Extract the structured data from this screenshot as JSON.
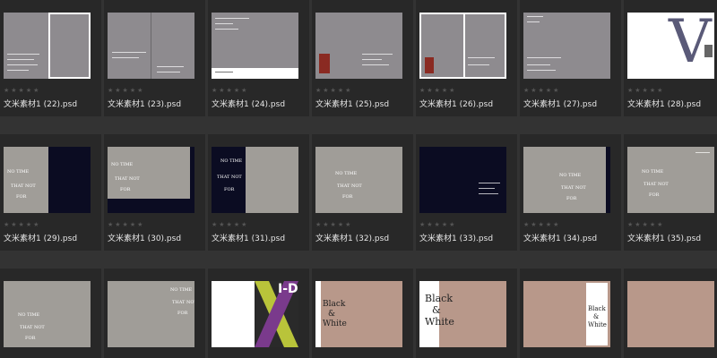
{
  "files": [
    {
      "name": "文米素材1 (22).psd",
      "stars": "★★★★★"
    },
    {
      "name": "文米素材1 (23).psd",
      "stars": "★★★★★"
    },
    {
      "name": "文米素材1 (24).psd",
      "stars": "★★★★★"
    },
    {
      "name": "文米素材1 (25).psd",
      "stars": "★★★★★"
    },
    {
      "name": "文米素材1 (26).psd",
      "stars": "★★★★★"
    },
    {
      "name": "文米素材1 (27).psd",
      "stars": "★★★★★"
    },
    {
      "name": "文米素材1 (28).psd",
      "stars": "★★★★★"
    },
    {
      "name": "文米素材1 (29).psd",
      "stars": "★★★★★"
    },
    {
      "name": "文米素材1 (30).psd",
      "stars": "★★★★★"
    },
    {
      "name": "文米素材1 (31).psd",
      "stars": "★★★★★"
    },
    {
      "name": "文米素材1 (32).psd",
      "stars": "★★★★★"
    },
    {
      "name": "文米素材1 (33).psd",
      "stars": "★★★★★"
    },
    {
      "name": "文米素材1 (34).psd",
      "stars": "★★★★★"
    },
    {
      "name": "文米素材1 (35).psd",
      "stars": "★★★★★"
    },
    {
      "name": "",
      "stars": ""
    },
    {
      "name": "",
      "stars": ""
    },
    {
      "name": "",
      "stars": ""
    },
    {
      "name": "",
      "stars": ""
    },
    {
      "name": "",
      "stars": ""
    },
    {
      "name": "",
      "stars": ""
    },
    {
      "name": "",
      "stars": ""
    }
  ],
  "thumb_text": {
    "no_time": "NO TIME",
    "that_not": "THAT NOT",
    "for": "FOR",
    "idg": "I-D",
    "black": "Black",
    "amp": "&",
    "white": "White",
    "v": "V"
  },
  "colors": {
    "background": "#333333",
    "cell": "#282828",
    "thumb_gray": "#8e8b8f",
    "thumb_warm": "#a09d98",
    "thumb_tan": "#b8988a",
    "thumb_navy": "#0b0c22"
  }
}
